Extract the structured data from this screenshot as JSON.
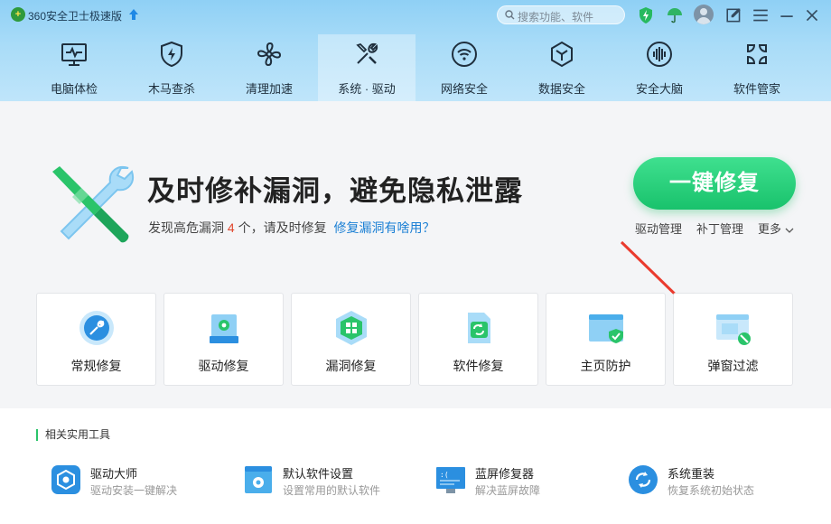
{
  "app": {
    "title": "360安全卫士极速版",
    "logo_glyph": "+"
  },
  "search": {
    "placeholder": "搜索功能、软件"
  },
  "titlebar_icons": [
    "protection-shield-icon",
    "umbrella-icon",
    "avatar",
    "feedback-icon",
    "menu-icon",
    "minimize-icon",
    "close-icon"
  ],
  "nav": {
    "items": [
      {
        "label": "电脑体检",
        "icon": "monitor-icon"
      },
      {
        "label": "木马查杀",
        "icon": "shield-bolt-icon"
      },
      {
        "label": "清理加速",
        "icon": "fan-icon"
      },
      {
        "label": "系统 · 驱动",
        "icon": "wrench-icon",
        "active": true
      },
      {
        "label": "网络安全",
        "icon": "wifi-icon"
      },
      {
        "label": "数据安全",
        "icon": "hexagon-icon"
      },
      {
        "label": "安全大脑",
        "icon": "brain-icon"
      },
      {
        "label": "软件管家",
        "icon": "apps-icon"
      }
    ]
  },
  "hero": {
    "headline": "及时修补漏洞，避免隐私泄露",
    "sub_prefix": "发现高危漏洞",
    "count": "4",
    "sub_suffix": "个，请及时修复",
    "help_link": "修复漏洞有啥用？",
    "fix_button": "一键修复",
    "links": [
      "驱动管理",
      "补丁管理",
      "更多"
    ]
  },
  "cards": [
    {
      "label": "常规修复",
      "icon": "wrench-circle-icon"
    },
    {
      "label": "驱动修复",
      "icon": "drive-gear-icon"
    },
    {
      "label": "漏洞修复",
      "icon": "windows-shield-icon"
    },
    {
      "label": "软件修复",
      "icon": "refresh-file-icon"
    },
    {
      "label": "主页防护",
      "icon": "browser-shield-icon"
    },
    {
      "label": "弹窗过滤",
      "icon": "popup-block-icon"
    }
  ],
  "tools": {
    "title": "相关实用工具",
    "items": [
      {
        "name": "驱动大师",
        "desc": "驱动安装一键解决",
        "icon": "driver-master-icon"
      },
      {
        "name": "默认软件设置",
        "desc": "设置常用的默认软件",
        "icon": "default-software-icon"
      },
      {
        "name": "蓝屏修复器",
        "desc": "解决蓝屏故障",
        "icon": "bluescreen-icon"
      },
      {
        "name": "系统重装",
        "desc": "恢复系统初始状态",
        "icon": "system-reinstall-icon"
      }
    ]
  },
  "colors": {
    "accent_green": "#19c26c",
    "link_blue": "#1a7fd4",
    "warning_red": "#e0452c",
    "header_blue": "#a9dcf8"
  }
}
